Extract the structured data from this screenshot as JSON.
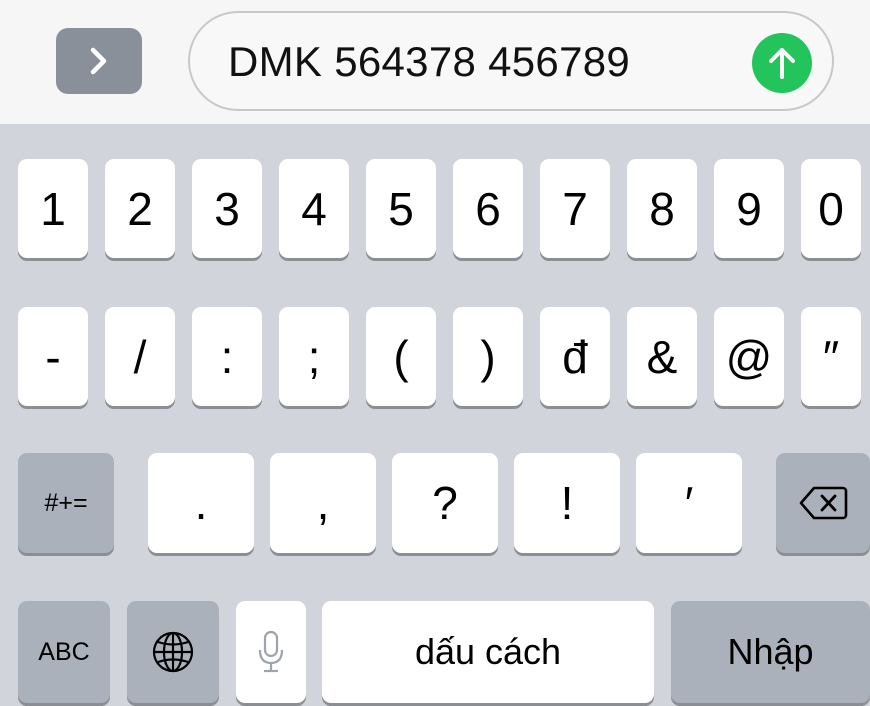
{
  "input": {
    "value": "DMK 564378 456789"
  },
  "icons": {
    "expand": "chevron-right-icon",
    "send": "arrow-up-icon",
    "delete": "backspace-icon",
    "globe": "globe-icon",
    "mic": "microphone-icon"
  },
  "colors": {
    "send": "#22c45b",
    "special_key": "#abb1bb",
    "keyboard_bg": "#d1d4da"
  },
  "keyboard": {
    "row1": [
      "1",
      "2",
      "3",
      "4",
      "5",
      "6",
      "7",
      "8",
      "9",
      "0"
    ],
    "row2": [
      "-",
      "/",
      ":",
      ";",
      "(",
      ")",
      "đ",
      "&",
      "@",
      "″"
    ],
    "row3": [
      ".",
      ",",
      "?",
      "!",
      "′"
    ],
    "more_symbols_label": "#+=",
    "abc_label": "ABC",
    "space_label": "dấu cách",
    "return_label": "Nhập"
  }
}
